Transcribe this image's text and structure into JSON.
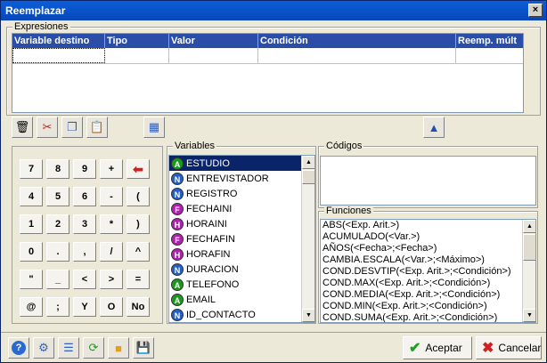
{
  "window": {
    "title": "Reemplazar",
    "close_label": "×"
  },
  "expresiones": {
    "label": "Expresiones",
    "columns": [
      "Variable destino",
      "Tipo",
      "Valor",
      "Condición",
      "Reemp. múlt"
    ]
  },
  "keypad": {
    "keys": [
      [
        "7",
        "8",
        "9",
        "+",
        "⬅"
      ],
      [
        "4",
        "5",
        "6",
        "-",
        "("
      ],
      [
        "1",
        "2",
        "3",
        "*",
        ")"
      ],
      [
        "0",
        ".",
        ",",
        "/",
        "^"
      ],
      [
        "\"",
        "_",
        "<",
        ">",
        "="
      ],
      [
        "@",
        ";",
        "Y",
        "O",
        "No"
      ]
    ]
  },
  "variables": {
    "label": "Variables",
    "items": [
      {
        "type": "A",
        "name": "ESTUDIO",
        "color": "#1a9a1a"
      },
      {
        "type": "N",
        "name": "ENTREVISTADOR",
        "color": "#2060c8"
      },
      {
        "type": "N",
        "name": "REGISTRO",
        "color": "#2060c8"
      },
      {
        "type": "F",
        "name": "FECHAINI",
        "color": "#b020b0"
      },
      {
        "type": "H",
        "name": "HORAINI",
        "color": "#b020b0"
      },
      {
        "type": "F",
        "name": "FECHAFIN",
        "color": "#b020b0"
      },
      {
        "type": "H",
        "name": "HORAFIN",
        "color": "#b020b0"
      },
      {
        "type": "N",
        "name": "DURACION",
        "color": "#2060c8"
      },
      {
        "type": "A",
        "name": "TELEFONO",
        "color": "#1a9a1a"
      },
      {
        "type": "A",
        "name": "EMAIL",
        "color": "#1a9a1a"
      },
      {
        "type": "N",
        "name": "ID_CONTACTO",
        "color": "#2060c8"
      }
    ]
  },
  "codigos": {
    "label": "Códigos"
  },
  "funciones": {
    "label": "Funciones",
    "items": [
      "ABS(<Exp. Arit.>)",
      "ACUMULADO(<Var.>)",
      "AÑOS(<Fecha>;<Fecha>)",
      "CAMBIA.ESCALA(<Var.>;<Máximo>)",
      "COND.DESVTIP(<Exp. Arit.>;<Condición>)",
      "COND.MAX(<Exp. Arit.>;<Condición>)",
      "COND.MEDIA(<Exp. Arit.>;<Condición>)",
      "COND.MIN(<Exp. Arit.>;<Condición>)",
      "COND.SUMA(<Exp. Arit.>;<Condición>)"
    ]
  },
  "buttons": {
    "accept": "Aceptar",
    "cancel": "Cancelar"
  }
}
